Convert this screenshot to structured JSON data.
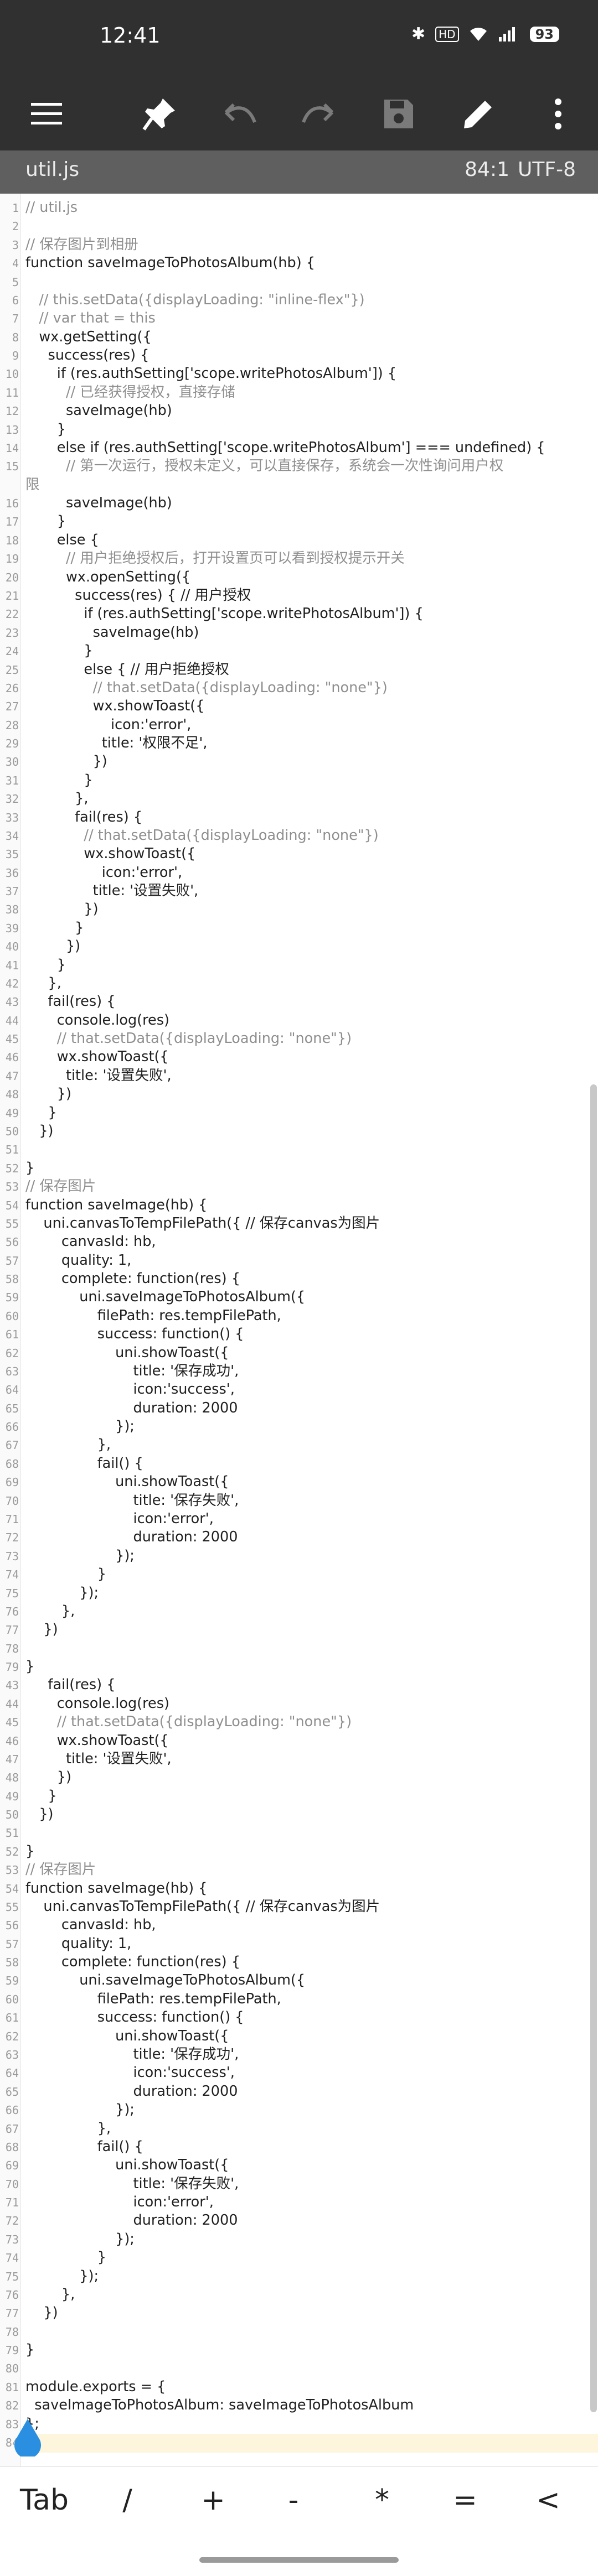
{
  "status": {
    "time": "12:41",
    "battery": "93",
    "hd": "HD"
  },
  "filebar": {
    "name": "util.js",
    "position": "84:1",
    "encoding": "UTF-8"
  },
  "keys": [
    "Tab",
    "/",
    "+",
    "-",
    "*",
    "=",
    "<"
  ],
  "code": [
    {
      "n": "1",
      "t": "// util.js",
      "c": "cm"
    },
    {
      "n": "2",
      "t": "",
      "c": ""
    },
    {
      "n": "3",
      "t": "// 保存图片到相册",
      "c": "cm"
    },
    {
      "n": "4",
      "t": "function saveImageToPhotosAlbum(hb) {",
      "c": ""
    },
    {
      "n": "5",
      "t": "",
      "c": ""
    },
    {
      "n": "6",
      "t": "   // this.setData({displayLoading: \"inline-flex\"})",
      "c": "cm"
    },
    {
      "n": "7",
      "t": "   // var that = this",
      "c": "cm"
    },
    {
      "n": "8",
      "t": "   wx.getSetting({",
      "c": ""
    },
    {
      "n": "9",
      "t": "     success(res) {",
      "c": ""
    },
    {
      "n": "10",
      "t": "       if (res.authSetting['scope.writePhotosAlbum']) {",
      "c": ""
    },
    {
      "n": "11",
      "t": "         // 已经获得授权，直接存储",
      "c": "cm"
    },
    {
      "n": "12",
      "t": "         saveImage(hb)",
      "c": ""
    },
    {
      "n": "13",
      "t": "       }",
      "c": ""
    },
    {
      "n": "14",
      "t": "       else if (res.authSetting['scope.writePhotosAlbum'] === undefined) {",
      "c": ""
    },
    {
      "n": "15",
      "t": "         // 第一次运行，授权未定义，可以直接保存，系统会一次性询问用户权",
      "c": "cm"
    },
    {
      "n": "",
      "t": "限",
      "c": "cm"
    },
    {
      "n": "16",
      "t": "         saveImage(hb)",
      "c": ""
    },
    {
      "n": "17",
      "t": "       }",
      "c": ""
    },
    {
      "n": "18",
      "t": "       else {",
      "c": ""
    },
    {
      "n": "19",
      "t": "         // 用户拒绝授权后，打开设置页可以看到授权提示开关",
      "c": "cm"
    },
    {
      "n": "20",
      "t": "         wx.openSetting({",
      "c": ""
    },
    {
      "n": "21",
      "t": "           success(res) { // 用户授权",
      "c": ""
    },
    {
      "n": "22",
      "t": "             if (res.authSetting['scope.writePhotosAlbum']) {",
      "c": ""
    },
    {
      "n": "23",
      "t": "               saveImage(hb)",
      "c": ""
    },
    {
      "n": "24",
      "t": "             }",
      "c": ""
    },
    {
      "n": "25",
      "t": "             else { // 用户拒绝授权",
      "c": ""
    },
    {
      "n": "26",
      "t": "               // that.setData({displayLoading: \"none\"})",
      "c": "cm"
    },
    {
      "n": "27",
      "t": "               wx.showToast({",
      "c": ""
    },
    {
      "n": "28",
      "t": "                   icon:'error',",
      "c": ""
    },
    {
      "n": "29",
      "t": "                 title: '权限不足',",
      "c": ""
    },
    {
      "n": "30",
      "t": "               })",
      "c": ""
    },
    {
      "n": "31",
      "t": "             }",
      "c": ""
    },
    {
      "n": "32",
      "t": "           },",
      "c": ""
    },
    {
      "n": "33",
      "t": "           fail(res) {",
      "c": ""
    },
    {
      "n": "34",
      "t": "             // that.setData({displayLoading: \"none\"})",
      "c": "cm"
    },
    {
      "n": "35",
      "t": "             wx.showToast({",
      "c": ""
    },
    {
      "n": "36",
      "t": "                 icon:'error',",
      "c": ""
    },
    {
      "n": "37",
      "t": "               title: '设置失败',",
      "c": ""
    },
    {
      "n": "38",
      "t": "             })",
      "c": ""
    },
    {
      "n": "39",
      "t": "           }",
      "c": ""
    },
    {
      "n": "40",
      "t": "         })",
      "c": ""
    },
    {
      "n": "41",
      "t": "       }",
      "c": ""
    },
    {
      "n": "42",
      "t": "     },",
      "c": ""
    },
    {
      "n": "43",
      "t": "     fail(res) {",
      "c": ""
    },
    {
      "n": "44",
      "t": "       console.log(res)",
      "c": ""
    },
    {
      "n": "45",
      "t": "       // that.setData({displayLoading: \"none\"})",
      "c": "cm"
    },
    {
      "n": "46",
      "t": "       wx.showToast({",
      "c": ""
    },
    {
      "n": "47",
      "t": "         title: '设置失败',",
      "c": ""
    },
    {
      "n": "48",
      "t": "       })",
      "c": ""
    },
    {
      "n": "49",
      "t": "     }",
      "c": ""
    },
    {
      "n": "50",
      "t": "   })",
      "c": ""
    },
    {
      "n": "51",
      "t": "",
      "c": ""
    },
    {
      "n": "52",
      "t": "}",
      "c": ""
    },
    {
      "n": "53",
      "t": "// 保存图片",
      "c": "cm"
    },
    {
      "n": "54",
      "t": "function saveImage(hb) {",
      "c": ""
    },
    {
      "n": "55",
      "t": "    uni.canvasToTempFilePath({ // 保存canvas为图片",
      "c": ""
    },
    {
      "n": "56",
      "t": "        canvasId: hb,",
      "c": ""
    },
    {
      "n": "57",
      "t": "        quality: 1,",
      "c": ""
    },
    {
      "n": "58",
      "t": "        complete: function(res) {",
      "c": ""
    },
    {
      "n": "59",
      "t": "            uni.saveImageToPhotosAlbum({",
      "c": ""
    },
    {
      "n": "60",
      "t": "                filePath: res.tempFilePath,",
      "c": ""
    },
    {
      "n": "61",
      "t": "                success: function() {",
      "c": ""
    },
    {
      "n": "62",
      "t": "                    uni.showToast({",
      "c": ""
    },
    {
      "n": "63",
      "t": "                        title: '保存成功',",
      "c": ""
    },
    {
      "n": "64",
      "t": "                        icon:'success',",
      "c": ""
    },
    {
      "n": "65",
      "t": "                        duration: 2000",
      "c": ""
    },
    {
      "n": "66",
      "t": "                    });",
      "c": ""
    },
    {
      "n": "67",
      "t": "                },",
      "c": ""
    },
    {
      "n": "68",
      "t": "                fail() {",
      "c": ""
    },
    {
      "n": "69",
      "t": "                    uni.showToast({",
      "c": ""
    },
    {
      "n": "70",
      "t": "                        title: '保存失败',",
      "c": ""
    },
    {
      "n": "71",
      "t": "                        icon:'error',",
      "c": ""
    },
    {
      "n": "72",
      "t": "                        duration: 2000",
      "c": ""
    },
    {
      "n": "73",
      "t": "                    });",
      "c": ""
    },
    {
      "n": "74",
      "t": "                }",
      "c": ""
    },
    {
      "n": "75",
      "t": "            });",
      "c": ""
    },
    {
      "n": "76",
      "t": "        },",
      "c": ""
    },
    {
      "n": "77",
      "t": "    })",
      "c": ""
    },
    {
      "n": "78",
      "t": "",
      "c": ""
    },
    {
      "n": "79",
      "t": "}",
      "c": ""
    },
    {
      "n": "43",
      "t": "     fail(res) {",
      "c": ""
    },
    {
      "n": "44",
      "t": "       console.log(res)",
      "c": ""
    },
    {
      "n": "45",
      "t": "       // that.setData({displayLoading: \"none\"})",
      "c": "cm"
    },
    {
      "n": "46",
      "t": "       wx.showToast({",
      "c": ""
    },
    {
      "n": "47",
      "t": "         title: '设置失败',",
      "c": ""
    },
    {
      "n": "48",
      "t": "       })",
      "c": ""
    },
    {
      "n": "49",
      "t": "     }",
      "c": ""
    },
    {
      "n": "50",
      "t": "   })",
      "c": ""
    },
    {
      "n": "51",
      "t": "",
      "c": ""
    },
    {
      "n": "52",
      "t": "}",
      "c": ""
    },
    {
      "n": "53",
      "t": "// 保存图片",
      "c": "cm"
    },
    {
      "n": "54",
      "t": "function saveImage(hb) {",
      "c": ""
    },
    {
      "n": "55",
      "t": "    uni.canvasToTempFilePath({ // 保存canvas为图片",
      "c": ""
    },
    {
      "n": "56",
      "t": "        canvasId: hb,",
      "c": ""
    },
    {
      "n": "57",
      "t": "        quality: 1,",
      "c": ""
    },
    {
      "n": "58",
      "t": "        complete: function(res) {",
      "c": ""
    },
    {
      "n": "59",
      "t": "            uni.saveImageToPhotosAlbum({",
      "c": ""
    },
    {
      "n": "60",
      "t": "                filePath: res.tempFilePath,",
      "c": ""
    },
    {
      "n": "61",
      "t": "                success: function() {",
      "c": ""
    },
    {
      "n": "62",
      "t": "                    uni.showToast({",
      "c": ""
    },
    {
      "n": "63",
      "t": "                        title: '保存成功',",
      "c": ""
    },
    {
      "n": "64",
      "t": "                        icon:'success',",
      "c": ""
    },
    {
      "n": "65",
      "t": "                        duration: 2000",
      "c": ""
    },
    {
      "n": "66",
      "t": "                    });",
      "c": ""
    },
    {
      "n": "67",
      "t": "                },",
      "c": ""
    },
    {
      "n": "68",
      "t": "                fail() {",
      "c": ""
    },
    {
      "n": "69",
      "t": "                    uni.showToast({",
      "c": ""
    },
    {
      "n": "70",
      "t": "                        title: '保存失败',",
      "c": ""
    },
    {
      "n": "71",
      "t": "                        icon:'error',",
      "c": ""
    },
    {
      "n": "72",
      "t": "                        duration: 2000",
      "c": ""
    },
    {
      "n": "73",
      "t": "                    });",
      "c": ""
    },
    {
      "n": "74",
      "t": "                }",
      "c": ""
    },
    {
      "n": "75",
      "t": "            });",
      "c": ""
    },
    {
      "n": "76",
      "t": "        },",
      "c": ""
    },
    {
      "n": "77",
      "t": "    })",
      "c": ""
    },
    {
      "n": "78",
      "t": "",
      "c": ""
    },
    {
      "n": "79",
      "t": "}",
      "c": ""
    },
    {
      "n": "80",
      "t": "",
      "c": ""
    },
    {
      "n": "81",
      "t": "module.exports = {",
      "c": ""
    },
    {
      "n": "82",
      "t": "  saveImageToPhotosAlbum: saveImageToPhotosAlbum",
      "c": ""
    },
    {
      "n": "83",
      "t": "};",
      "c": ""
    },
    {
      "n": "84",
      "t": "",
      "c": ""
    }
  ]
}
